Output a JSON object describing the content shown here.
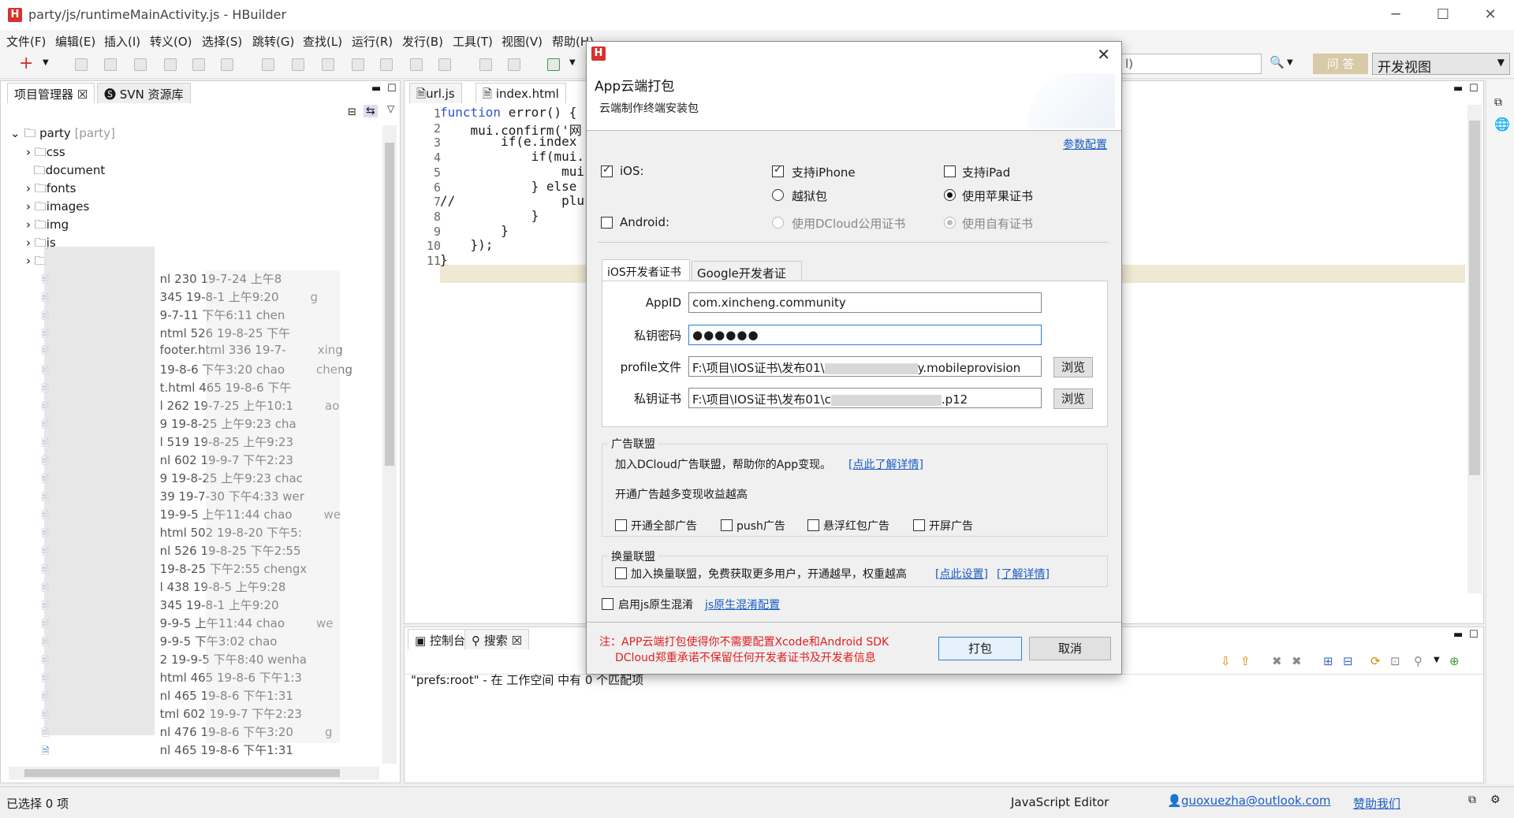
{
  "window": {
    "title": "party/js/runtimeMainActivity.js  -  HBuilder",
    "icon": "H",
    "minimize": "─",
    "maximize": "☐",
    "close": "✕"
  },
  "menu": [
    "文件(F)",
    "编辑(E)",
    "插入(I)",
    "转义(O)",
    "选择(S)",
    "跳转(G)",
    "查找(L)",
    "运行(R)",
    "发行(B)",
    "工具(T)",
    "视图(V)",
    "帮助(H)"
  ],
  "toolbar": {
    "search_text": "l)",
    "qa_label": "问 答",
    "view_mode": "开发视图"
  },
  "left_panel": {
    "tabs": [
      "项目管理器",
      "SVN 资源库"
    ],
    "tree": [
      {
        "label": "party",
        "suffix": "[party]"
      },
      {
        "label": "css"
      },
      {
        "label": "document"
      },
      {
        "label": "fonts"
      },
      {
        "label": "images"
      },
      {
        "label": "img"
      },
      {
        "label": "js"
      }
    ],
    "files": [
      "nl 230  19-7-24 上午8",
      "345  19-8-1 上午9:20",
      "9-7-11 下午6:11  chen",
      "ntml 526  19-8-25 下午",
      "footer.html 336  19-7-",
      "19-8-6 下午3:20  chao",
      "t.html 465  19-8-6 下午",
      "l 262  19-7-25 上午10:1",
      "9  19-8-25 上午9:23  cha",
      "l 519  19-8-25 上午9:23",
      "nl 602  19-9-7 下午2:23",
      "9  19-8-25 上午9:23  chac",
      "39  19-7-30 下午4:33  wer",
      "19-9-5 上午11:44  chao",
      "html 502  19-8-20 下午5:",
      "nl 526  19-8-25 下午2:55",
      "19-8-25 下午2:55  chengx",
      "l 438  19-8-5 上午9:28",
      "345  19-8-1 上午9:20",
      "9-9-5 上午11:44  chao",
      "9-9-5 下午3:02  chao",
      "2  19-9-5 下午8:40  wenha",
      "html 465  19-8-6 下午1:3",
      "nl 465  19-8-6 下午1:31",
      "tml 602  19-9-7 下午2:23",
      "nl 476  19-8-6 下午3:20",
      "nl 465  19-8-6 下午1:31"
    ],
    "file_extras": {
      "r1": "g",
      "r4": "xing",
      "r5": "cheng",
      "r7": "ao",
      "r13": "we",
      "r19": "we",
      "r25": "g"
    }
  },
  "editor": {
    "tabs": [
      "url.js",
      "index.html"
    ],
    "line_numbers": [
      "1",
      "2",
      "3",
      "4",
      "5",
      "6",
      "7",
      "8",
      "9",
      "10",
      "11"
    ],
    "lines": [
      {
        "kw": "function",
        "rest": " error() {"
      },
      {
        "kw": "",
        "rest": "    mui.confirm('网"
      },
      {
        "kw": "",
        "rest": "        if(e.index"
      },
      {
        "kw": "",
        "rest": "            if(mui."
      },
      {
        "kw": "",
        "rest": "                mui"
      },
      {
        "kw": "",
        "rest": "            } else"
      },
      {
        "kw": "",
        "rest": "//              plu"
      },
      {
        "kw": "",
        "rest": "            }"
      },
      {
        "kw": "",
        "rest": "        }"
      },
      {
        "kw": "",
        "rest": "    });"
      },
      {
        "kw": "",
        "rest": "}"
      }
    ]
  },
  "console": {
    "tabs": [
      "控制台",
      "搜索"
    ],
    "message": "\"prefs:root\" - 在 工作空间 中有 0 个匹配项"
  },
  "statusbar": {
    "selection": "已选择 0 项",
    "editor_type": "JavaScript Editor",
    "user": "guoxuezha@outlook.com",
    "sponsor": "赞助我们"
  },
  "dialog": {
    "title": "App云端打包",
    "subtitle": "云端制作终端安装包",
    "params_link": "参数配置",
    "ios_label": "iOS:",
    "android_label": "Android:",
    "iphone": "支持iPhone",
    "ipad": "支持iPad",
    "jailbreak": "越狱包",
    "apple_cert": "使用苹果证书",
    "dcloud_cert": "使用DCloud公用证书",
    "own_cert": "使用自有证书",
    "cert_tabs": [
      "iOS开发者证书",
      "Google开发者证书"
    ],
    "fields": {
      "appid_label": "AppID",
      "appid": "com.xincheng.community",
      "pwd_label": "私钥密码",
      "pwd": "●●●●●●",
      "profile_label": "profile文件",
      "profile": "F:\\项目\\IOS证书\\发布01\\",
      "profile_tail": "y.mobileprovision",
      "key_label": "私钥证书",
      "key": "F:\\项目\\IOS证书\\发布01\\c",
      "key_tail": ".p12",
      "browse": "浏览"
    },
    "ad": {
      "title": "广告联盟",
      "desc": "加入DCloud广告联盟，帮助你的App变现。",
      "desc_link": "[点此了解详情]",
      "more": "开通广告越多变现收益越高",
      "options": [
        "开通全部广告",
        "push广告",
        "悬浮红包广告",
        "开屏广告"
      ]
    },
    "swap": {
      "title": "换量联盟",
      "desc": "加入换量联盟，免费获取更多用户，开通越早，权重越高",
      "link1": "[点此设置]",
      "link2": "[了解详情]"
    },
    "obfuscate": "启用js原生混淆",
    "obfuscate_link": "js原生混淆配置",
    "note1": "注：APP云端打包使得你不需要配置Xcode和Android SDK",
    "note2": "DCloud郑重承诺不保留任何开发者证书及开发者信息",
    "pack_btn": "打包",
    "cancel_btn": "取消"
  }
}
